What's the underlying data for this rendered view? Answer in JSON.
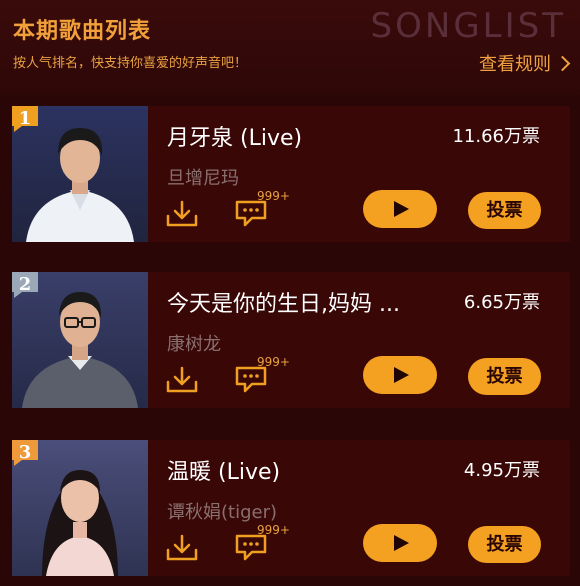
{
  "header": {
    "title": "本期歌曲列表",
    "subtitle": "按人气排名，快支持你喜爱的好声音吧！",
    "watermark": "SONGLIST",
    "rules_label": "查看规则"
  },
  "colors": {
    "background": "#2a0606",
    "card": "#3a0707",
    "accent": "#f4a020",
    "singer_text": "#8a6f6f",
    "rank1_badge": "#f0a020",
    "rank2_badge": "#9aa8b8",
    "rank3_badge": "#ef9a3a"
  },
  "songs": [
    {
      "rank": "1",
      "title": "月牙泉 (Live)",
      "singer": "旦增尼玛",
      "votes": "11.66万票",
      "comment_count": "999+",
      "vote_label": "投票",
      "icons": [
        "download-icon",
        "comment-icon",
        "play-icon"
      ]
    },
    {
      "rank": "2",
      "title": "今天是你的生日,妈妈 ...",
      "singer": "康树龙",
      "votes": "6.65万票",
      "comment_count": "999+",
      "vote_label": "投票",
      "icons": [
        "download-icon",
        "comment-icon",
        "play-icon"
      ]
    },
    {
      "rank": "3",
      "title": "温暖 (Live)",
      "singer": "谭秋娟(tiger)",
      "votes": "4.95万票",
      "comment_count": "999+",
      "vote_label": "投票",
      "icons": [
        "download-icon",
        "comment-icon",
        "play-icon"
      ]
    }
  ]
}
